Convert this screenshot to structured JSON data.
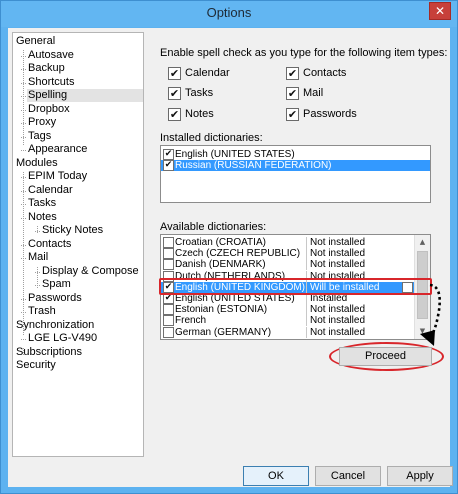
{
  "window": {
    "title": "Options",
    "close_glyph": "✕"
  },
  "tree": {
    "items": [
      {
        "label": "General"
      },
      {
        "label": "Autosave"
      },
      {
        "label": "Backup"
      },
      {
        "label": "Shortcuts"
      },
      {
        "label": "Spelling",
        "selected": true
      },
      {
        "label": "Dropbox"
      },
      {
        "label": "Proxy"
      },
      {
        "label": "Tags"
      },
      {
        "label": "Appearance"
      },
      {
        "label": "Modules"
      },
      {
        "label": "EPIM Today"
      },
      {
        "label": "Calendar"
      },
      {
        "label": "Tasks"
      },
      {
        "label": "Notes"
      },
      {
        "label": "Sticky Notes"
      },
      {
        "label": "Contacts"
      },
      {
        "label": "Mail"
      },
      {
        "label": "Display & Compose"
      },
      {
        "label": "Spam"
      },
      {
        "label": "Passwords"
      },
      {
        "label": "Trash"
      },
      {
        "label": "Synchronization"
      },
      {
        "label": "LGE LG-V490"
      },
      {
        "label": "Subscriptions"
      },
      {
        "label": "Security"
      }
    ]
  },
  "spelling": {
    "intro": "Enable spell check as you type for the following item types:",
    "types": [
      {
        "label": "Calendar",
        "checked": true
      },
      {
        "label": "Contacts",
        "checked": true
      },
      {
        "label": "Tasks",
        "checked": true
      },
      {
        "label": "Mail",
        "checked": true
      },
      {
        "label": "Notes",
        "checked": true
      },
      {
        "label": "Passwords",
        "checked": true
      }
    ],
    "installed_label": "Installed dictionaries:",
    "installed": [
      {
        "label": "English (UNITED STATES)",
        "checked": true
      },
      {
        "label": "Russian (RUSSIAN FEDERATION)",
        "checked": true,
        "selected": true
      }
    ],
    "available_label": "Available dictionaries:",
    "available": [
      {
        "name": "Croatian (CROATIA)",
        "status": "Not installed",
        "checked": false
      },
      {
        "name": "Czech (CZECH REPUBLIC)",
        "status": "Not installed",
        "checked": false
      },
      {
        "name": "Danish (DENMARK)",
        "status": "Not installed",
        "checked": false
      },
      {
        "name": "Dutch (NETHERLANDS)",
        "status": "Not installed",
        "checked": false
      },
      {
        "name": "English (UNITED KINGDOM)",
        "status": "Will be installed",
        "checked": true,
        "selected": true
      },
      {
        "name": "English (UNITED STATES)",
        "status": "Installed",
        "checked": true
      },
      {
        "name": "Estonian (ESTONIA)",
        "status": "Not installed",
        "checked": false
      },
      {
        "name": "French",
        "status": "Not installed",
        "checked": false
      },
      {
        "name": "German (GERMANY)",
        "status": "Not installed",
        "checked": false
      }
    ],
    "proceed_label": "Proceed"
  },
  "footer": {
    "ok_label": "OK",
    "cancel_label": "Cancel",
    "apply_label": "Apply"
  },
  "check_glyph": "✔",
  "colors": {
    "titlebar": "#62b6f2",
    "selection": "#3399ff",
    "annotation": "#d8262b",
    "close": "#c7403a"
  }
}
